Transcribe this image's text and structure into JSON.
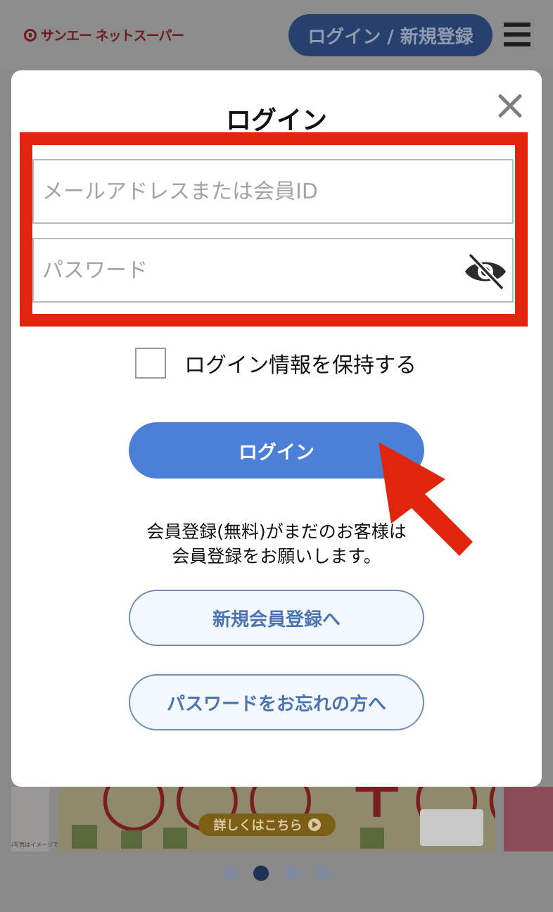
{
  "header": {
    "logo_text": "サンエー ネットスーパー",
    "login_register_label": "ログイン / 新規登録"
  },
  "background": {
    "banner_cta": "詳しくはこちら",
    "banner_left_caption": "(写真はイメージです)",
    "carousel": {
      "count": 4,
      "active_index": 1
    }
  },
  "modal": {
    "title": "ログイン",
    "email_placeholder": "メールアドレスまたは会員ID",
    "password_placeholder": "パスワード",
    "remember_label": "ログイン情報を保持する",
    "login_button": "ログイン",
    "notice_line1": "会員登録(無料)がまだのお客様は",
    "notice_line2": "会員登録をお願いします。",
    "register_button": "新規会員登録へ",
    "forgot_button": "パスワードをお忘れの方へ"
  },
  "colors": {
    "annotation_red": "#e0250c",
    "primary_blue": "#4c7fd6",
    "outline_blue": "#4c74b0"
  },
  "icons": [
    "close-icon",
    "eye-slash-icon",
    "menu-icon",
    "logo-icon",
    "annotation-arrow"
  ]
}
